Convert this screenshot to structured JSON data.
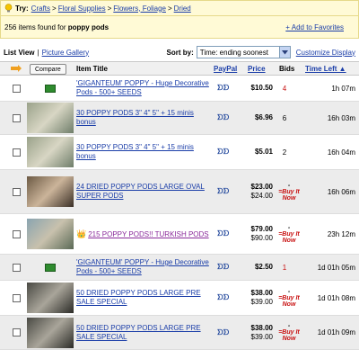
{
  "try_bar": {
    "label": "Try:",
    "links": [
      "Crafts",
      "Floral Supplies",
      "Flowers, Foliage",
      "Dried"
    ],
    "sep": ">"
  },
  "summary": {
    "count": "256",
    "text": " items found for ",
    "query": "poppy pods",
    "favorites": "+ Add to Favorites"
  },
  "toolbar": {
    "list_view": "List View",
    "divider": "|",
    "picture_gallery": "Picture Gallery",
    "sort_by": "Sort by:",
    "sort_value": "Time: ending soonest",
    "customize": "Customize Display"
  },
  "header": {
    "compare": "Compare",
    "item_title": "Item Title",
    "paypal": "PayPal",
    "price": "Price",
    "bids": "Bids",
    "time_left": "Time Left ▲"
  },
  "rows": [
    {
      "title": "'GIGANTEUM' POPPY - Huge Decorative Pods - 500+ SEEDS",
      "price": "$10.50",
      "price2": "",
      "bids": "4",
      "bid_red": true,
      "time": "1h 07m",
      "pp": "ᗤᗤ"
    },
    {
      "title": "30 POPPY PODS 3\" 4\" 5\" + 15 minis bonus",
      "price": "$6.96",
      "price2": "",
      "bids": "6",
      "bid_red": false,
      "time": "16h 03m",
      "pp": "ᗤᗤ"
    },
    {
      "title": "30 POPPY PODS 3\" 4\" 5\" + 15 minis bonus",
      "price": "$5.01",
      "price2": "",
      "bids": "2",
      "bid_red": false,
      "time": "16h 04m",
      "pp": "ᗤᗤ"
    },
    {
      "title": "24 DRIED POPPY PODS LARGE OVAL SUPER PODS",
      "price": "$23.00",
      "price2": "$24.00",
      "bids": "-",
      "bin": "=Buy It Now",
      "time": "16h 06m",
      "pp": "ᗤᗤ"
    },
    {
      "title": "215 POPPY PODS!! TURKISH PODS",
      "price": "$79.00",
      "price2": "$90.00",
      "bids": "-",
      "bin": "=Buy It Now",
      "time": "23h 12m",
      "pp": "ᗤᗤ",
      "crown": "👑"
    },
    {
      "title": "'GIGANTEUM' POPPY - Huge Decorative Pods - 500+ SEEDS",
      "price": "$2.50",
      "price2": "",
      "bids": "1",
      "bid_red": true,
      "time": "1d 01h 05m",
      "pp": "ᗤᗤ"
    },
    {
      "title": "50 DRIED POPPY PODS LARGE PRE SALE SPECIAL",
      "price": "$38.00",
      "price2": "$39.00",
      "bids": "-",
      "bin": "=Buy It Now",
      "time": "1d 01h 08m",
      "pp": "ᗤᗤ"
    },
    {
      "title": "50 DRIED POPPY PODS LARGE PRE SALE SPECIAL",
      "price": "$38.00",
      "price2": "$39.00",
      "bids": "-",
      "bin": "=Buy It Now",
      "time": "1d 01h 09m",
      "pp": "ᗤᗤ"
    }
  ]
}
